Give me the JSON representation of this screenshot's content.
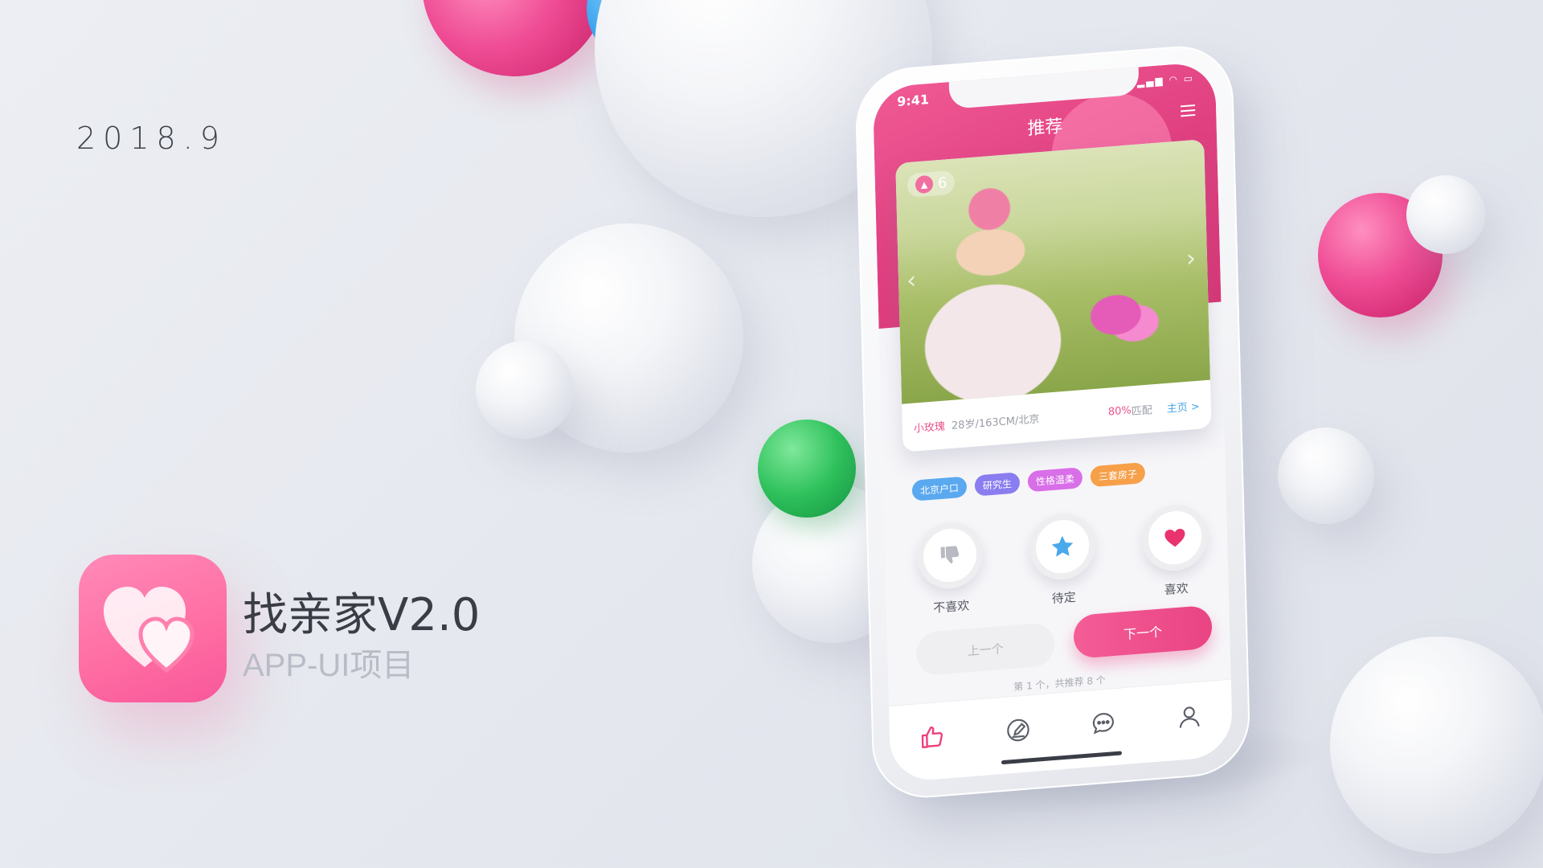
{
  "branding": {
    "date": "2018.9",
    "app_name": "找亲家V2.0",
    "subtitle": "APP-UI项目"
  },
  "colors": {
    "brand_pink": "#ee4f8b",
    "tag_blue": "#5aa9f0",
    "tag_purple": "#8a7df0",
    "tag_magenta": "#d86fe8",
    "tag_orange": "#f7a04a",
    "link_blue": "#4aa5e8"
  },
  "status_bar": {
    "time": "9:41"
  },
  "nav": {
    "title": "推荐",
    "menu_icon": "menu-icon"
  },
  "profile_card": {
    "photo_count": "6",
    "name": "小玫瑰",
    "details": "28岁/163CM/北京",
    "match_percent": "80%",
    "match_label": "匹配",
    "home_link": "主页 >"
  },
  "tags": [
    {
      "label": "北京户口",
      "color": "#5aa9f0"
    },
    {
      "label": "研究生",
      "color": "#8a7df0"
    },
    {
      "label": "性格温柔",
      "color": "#d86fe8"
    },
    {
      "label": "三套房子",
      "color": "#f7a04a"
    }
  ],
  "actions": [
    {
      "label": "不喜欢",
      "icon": "thumbs-down-icon"
    },
    {
      "label": "待定",
      "icon": "star-icon"
    },
    {
      "label": "喜欢",
      "icon": "heart-icon"
    }
  ],
  "buttons": {
    "prev": "上一个",
    "next": "下一个"
  },
  "pager": {
    "text": "第 1 个，共推荐 8 个"
  },
  "tabbar": [
    {
      "icon": "thumbs-up-icon",
      "active": true
    },
    {
      "icon": "edit-icon",
      "active": false
    },
    {
      "icon": "chat-icon",
      "active": false
    },
    {
      "icon": "profile-icon",
      "active": false
    }
  ]
}
